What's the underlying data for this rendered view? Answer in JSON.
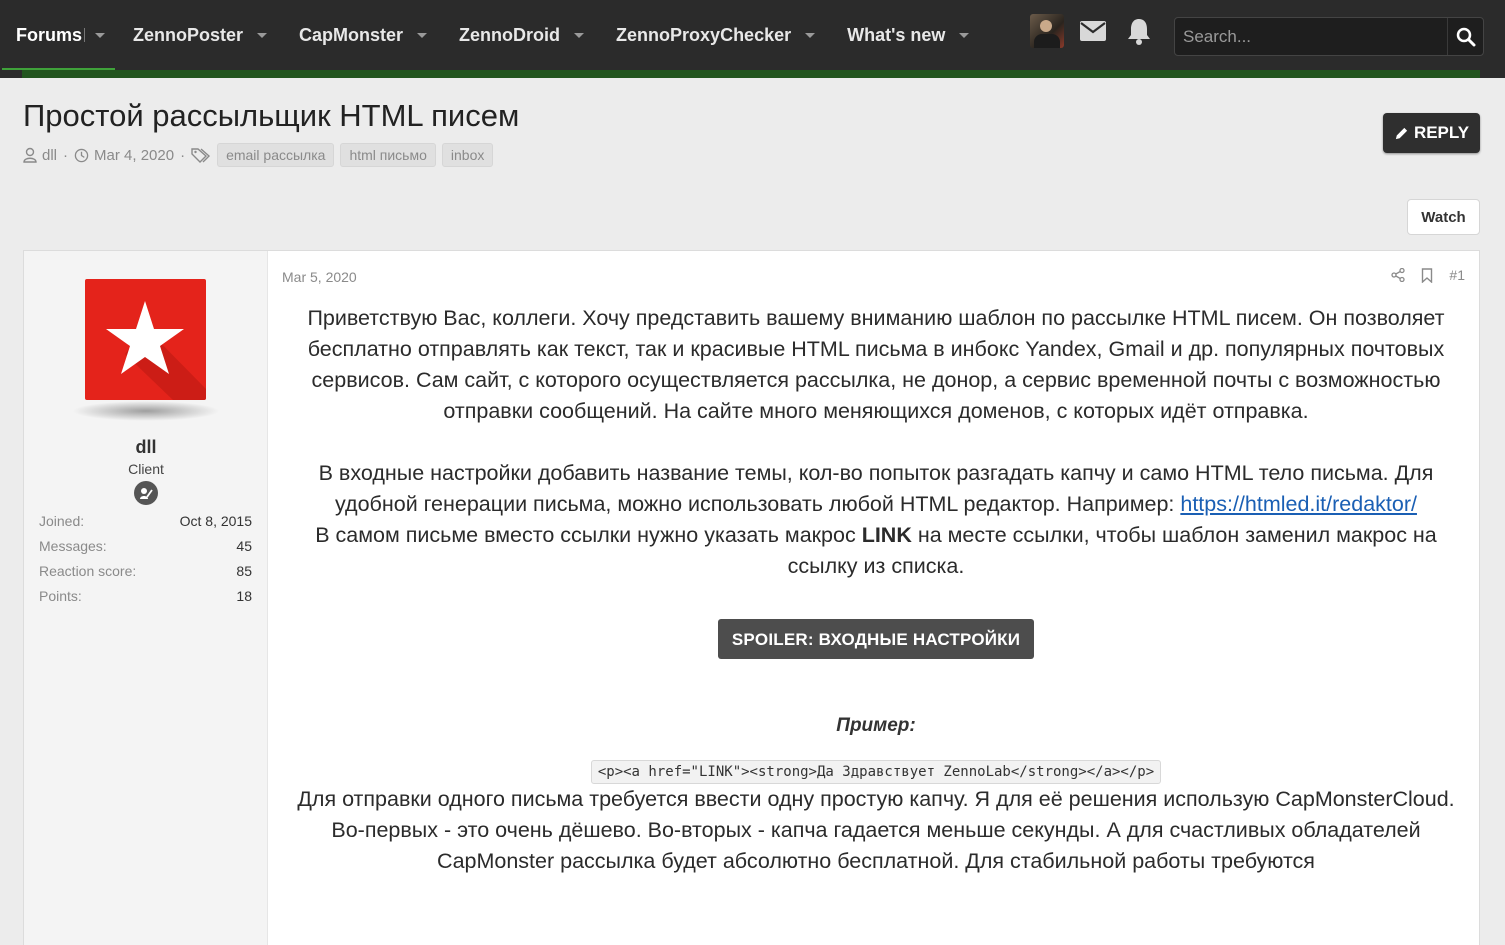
{
  "nav": {
    "items": [
      {
        "label": "Forums"
      },
      {
        "label": "ZennoPoster"
      },
      {
        "label": "CapMonster"
      },
      {
        "label": "ZennoDroid"
      },
      {
        "label": "ZennoProxyChecker"
      },
      {
        "label": "What's new"
      }
    ],
    "search_placeholder": "Search..."
  },
  "thread": {
    "title": "Простой рассыльщик HTML писем",
    "author": "dll",
    "date": "Mar 4, 2020",
    "tags": [
      "email рассылка",
      "html письмо",
      "inbox"
    ],
    "reply_label": "REPLY",
    "watch_label": "Watch"
  },
  "user": {
    "name": "dll",
    "role": "Client",
    "stats": [
      {
        "k": "Joined:",
        "v": "Oct 8, 2015"
      },
      {
        "k": "Messages:",
        "v": "45"
      },
      {
        "k": "Reaction score:",
        "v": "85"
      },
      {
        "k": "Points:",
        "v": "18"
      }
    ]
  },
  "post": {
    "date": "Mar 5, 2020",
    "number": "#1",
    "para1": "Приветствую Вас, коллеги. Хочу представить вашему вниманию шаблон по рассылке HTML писем. Он позволяет бесплатно отправлять как текст, так и красивые HTML письма в инбокс Yandex, Gmail и др. популярных почтовых сервисов. Сам сайт, с которого осуществляется рассылка, не донор, а сервис временной почты с возможностью отправки сообщений. На сайте много меняющихся доменов, с которых идёт отправка.",
    "para2_a": "В входные настройки добавить название темы, кол-во попыток разгадать капчу и само HTML тело письма. Для удобной генерации письма, можно использовать любой HTML редактор. Например: ",
    "para2_link": "https://htmled.it/redaktor/",
    "para2_b": "В самом письме вместо ссылки нужно указать макрос ",
    "para2_bold": "LINK",
    "para2_c": " на месте ссылки, чтобы шаблон заменил макрос на ссылку из списка.",
    "spoiler_label": "SPOILER: ВХОДНЫЕ НАСТРОЙКИ",
    "example_label": "Пример:",
    "code": "<p><a href=\"LINK\"><strong>Да Здравствует ZennoLab</strong></a></p>",
    "para3": "Для отправки одного письма требуется ввести одну простую капчу. Я для её решения использую CapMonsterCloud. Во-первых - это очень дёшево. Во-вторых - капча гадается меньше секунды. А для счастливых обладателей CapMonster рассылка будет абсолютно бесплатной. Для стабильной работы требуются"
  }
}
